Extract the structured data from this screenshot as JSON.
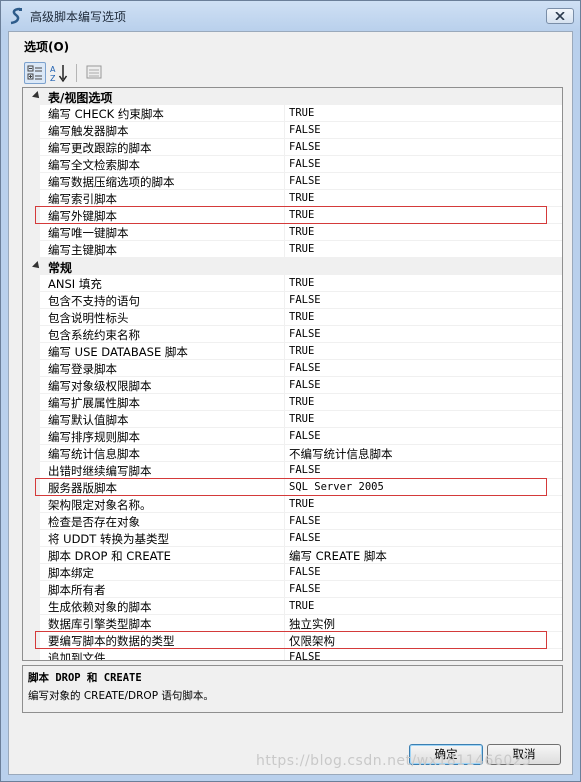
{
  "window": {
    "title": "高级脚本编写选项",
    "icon": "script-wizard-icon"
  },
  "section_label": "选项(O)",
  "toolbar": {
    "buttons": [
      {
        "name": "categorized-view",
        "icon": "categorized-icon",
        "active": true
      },
      {
        "name": "alphabetical-sort",
        "icon": "sort-az-icon",
        "active": false
      },
      {
        "name": "property-pages",
        "icon": "property-pages-icon",
        "active": false
      }
    ]
  },
  "grid": {
    "categories": [
      {
        "label": "表/视图选项",
        "rows": [
          {
            "name": "编写 CHECK 约束脚本",
            "value": "TRUE"
          },
          {
            "name": "编写触发器脚本",
            "value": "FALSE"
          },
          {
            "name": "编写更改跟踪的脚本",
            "value": "FALSE"
          },
          {
            "name": "编写全文检索脚本",
            "value": "FALSE"
          },
          {
            "name": "编写数据压缩选项的脚本",
            "value": "FALSE"
          },
          {
            "name": "编写索引脚本",
            "value": "TRUE"
          },
          {
            "name": "编写外键脚本",
            "value": "TRUE",
            "highlighted": true
          },
          {
            "name": "编写唯一键脚本",
            "value": "TRUE"
          },
          {
            "name": "编写主键脚本",
            "value": "TRUE"
          }
        ]
      },
      {
        "label": "常规",
        "rows": [
          {
            "name": "ANSI 填充",
            "value": "TRUE"
          },
          {
            "name": "包含不支持的语句",
            "value": "FALSE"
          },
          {
            "name": "包含说明性标头",
            "value": "TRUE"
          },
          {
            "name": "包含系统约束名称",
            "value": "FALSE"
          },
          {
            "name": "编写 USE DATABASE 脚本",
            "value": "TRUE"
          },
          {
            "name": "编写登录脚本",
            "value": "FALSE"
          },
          {
            "name": "编写对象级权限脚本",
            "value": "FALSE"
          },
          {
            "name": "编写扩展属性脚本",
            "value": "TRUE"
          },
          {
            "name": "编写默认值脚本",
            "value": "TRUE"
          },
          {
            "name": "编写排序规则脚本",
            "value": "FALSE"
          },
          {
            "name": "编写统计信息脚本",
            "value": "不编写统计信息脚本"
          },
          {
            "name": "出错时继续编写脚本",
            "value": "FALSE"
          },
          {
            "name": "服务器版脚本",
            "value": "SQL Server 2005",
            "highlighted": true
          },
          {
            "name": "架构限定对象名称。",
            "value": "TRUE"
          },
          {
            "name": "检查是否存在对象",
            "value": "FALSE"
          },
          {
            "name": "将 UDDT 转换为基类型",
            "value": "FALSE"
          },
          {
            "name": "脚本 DROP 和 CREATE",
            "value": "编写 CREATE 脚本"
          },
          {
            "name": "脚本绑定",
            "value": "FALSE"
          },
          {
            "name": "脚本所有者",
            "value": "FALSE"
          },
          {
            "name": "生成依赖对象的脚本",
            "value": "TRUE"
          },
          {
            "name": "数据库引擎类型脚本",
            "value": "独立实例"
          },
          {
            "name": "要编写脚本的数据的类型",
            "value": "仅限架构",
            "highlighted": true
          },
          {
            "name": "追加到文件",
            "value": "FALSE"
          }
        ]
      }
    ]
  },
  "description": {
    "title": "脚本 DROP 和 CREATE",
    "text": "编写对象的 CREATE/DROP 语句脚本。"
  },
  "buttons": {
    "ok": "确定",
    "cancel": "取消"
  },
  "watermark": "https://blog.csdn.net/wx1811466025",
  "colors": {
    "highlight_border": "#d43a3a",
    "title_gradient": "#b9d0ec"
  }
}
